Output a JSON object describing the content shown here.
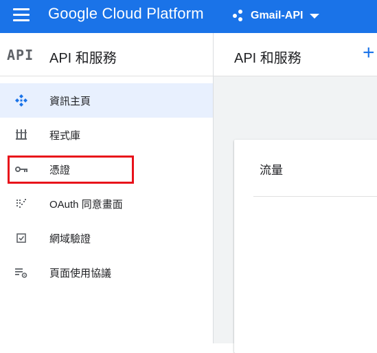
{
  "topbar": {
    "app_title": "Google Cloud Platform",
    "project_name": "Gmail-API",
    "bg_color": "#1a73e8"
  },
  "sidebar": {
    "logo_text": "API",
    "title": "API 和服務",
    "items": [
      {
        "label": "資訊主頁",
        "icon": "dashboard-icon",
        "active": true
      },
      {
        "label": "程式庫",
        "icon": "library-icon",
        "active": false
      },
      {
        "label": "憑證",
        "icon": "key-icon",
        "active": false,
        "highlighted": true
      },
      {
        "label": "OAuth 同意畫面",
        "icon": "oauth-consent-icon",
        "active": false
      },
      {
        "label": "網域驗證",
        "icon": "checkbox-icon",
        "active": false
      },
      {
        "label": "頁面使用協議",
        "icon": "settings-list-icon",
        "active": false
      }
    ]
  },
  "content": {
    "title": "API 和服務",
    "add_label": "+",
    "card_title": "流量"
  },
  "colors": {
    "accent": "#1a73e8",
    "active_bg": "#e8f0fe",
    "highlight_border": "#e8101a"
  }
}
